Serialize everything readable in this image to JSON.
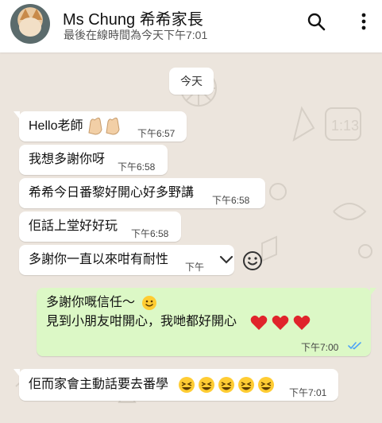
{
  "header": {
    "title": "Ms Chung 希希家長",
    "subtitle": "最後在線時間為今天下午7:01"
  },
  "icons": {
    "avatar": "dog-avatar",
    "search": "search-icon",
    "more": "more-vert-icon",
    "read": "double-check-icon",
    "react": "smiley-icon",
    "menu": "chevron-down-icon"
  },
  "colors": {
    "background": "#ece5dd",
    "incoming": "#ffffff",
    "outgoing": "#dcf8c6",
    "read_ticks": "#4fa3f7"
  },
  "date_chip": "今天",
  "messages": [
    {
      "text": "Hello老師",
      "emoji": "clapping-hands x2",
      "time": "下午6:57"
    },
    {
      "text": "我想多謝你呀",
      "time": "下午6:58"
    },
    {
      "text": "希希今日番黎好開心好多野講",
      "time": "下午6:58"
    },
    {
      "text": "佢話上堂好好玩",
      "time": "下午6:58"
    },
    {
      "text": "多謝你一直以來咁有耐性",
      "time": "下午"
    },
    {
      "line1": "多謝你嘅信任～",
      "line2": "見到小朋友咁開心，我哋都好開心",
      "emoji": "smiley + 3 red hearts",
      "time": "下午7:00"
    },
    {
      "text": "佢而家會主動話要去番學",
      "emoji": "laughing x5",
      "time": "下午7:01"
    }
  ]
}
